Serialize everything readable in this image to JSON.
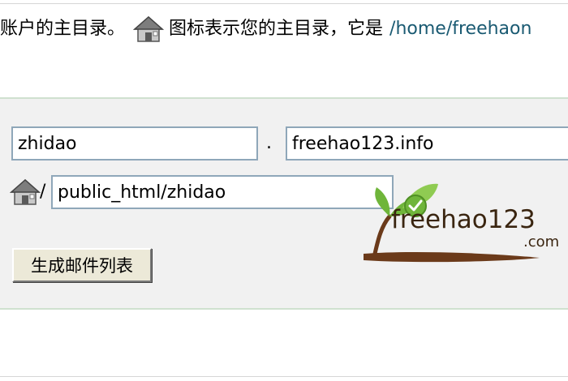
{
  "intro": {
    "text": "账户的主目录。",
    "text_after_icon": "图标表示您的主目录，它是",
    "home_path_link": "/home/freehaon"
  },
  "form": {
    "subdomain_value": "zhidao",
    "separator": ".",
    "domain_value": "freehao123.info",
    "path_separator": "/",
    "path_value": "public_html/zhidao",
    "generate_button": "生成邮件列表"
  },
  "watermark": {
    "text": "freehao123",
    "suffix": ".com"
  },
  "icons": [
    "home-icon",
    "checkmark-icon"
  ],
  "colors": {
    "link": "#1a5a72",
    "panel_bg": "#f1f1f1",
    "panel_border": "#cfe1cf",
    "logo_green": "#6fb53a",
    "logo_brown": "#6b3a1a"
  }
}
